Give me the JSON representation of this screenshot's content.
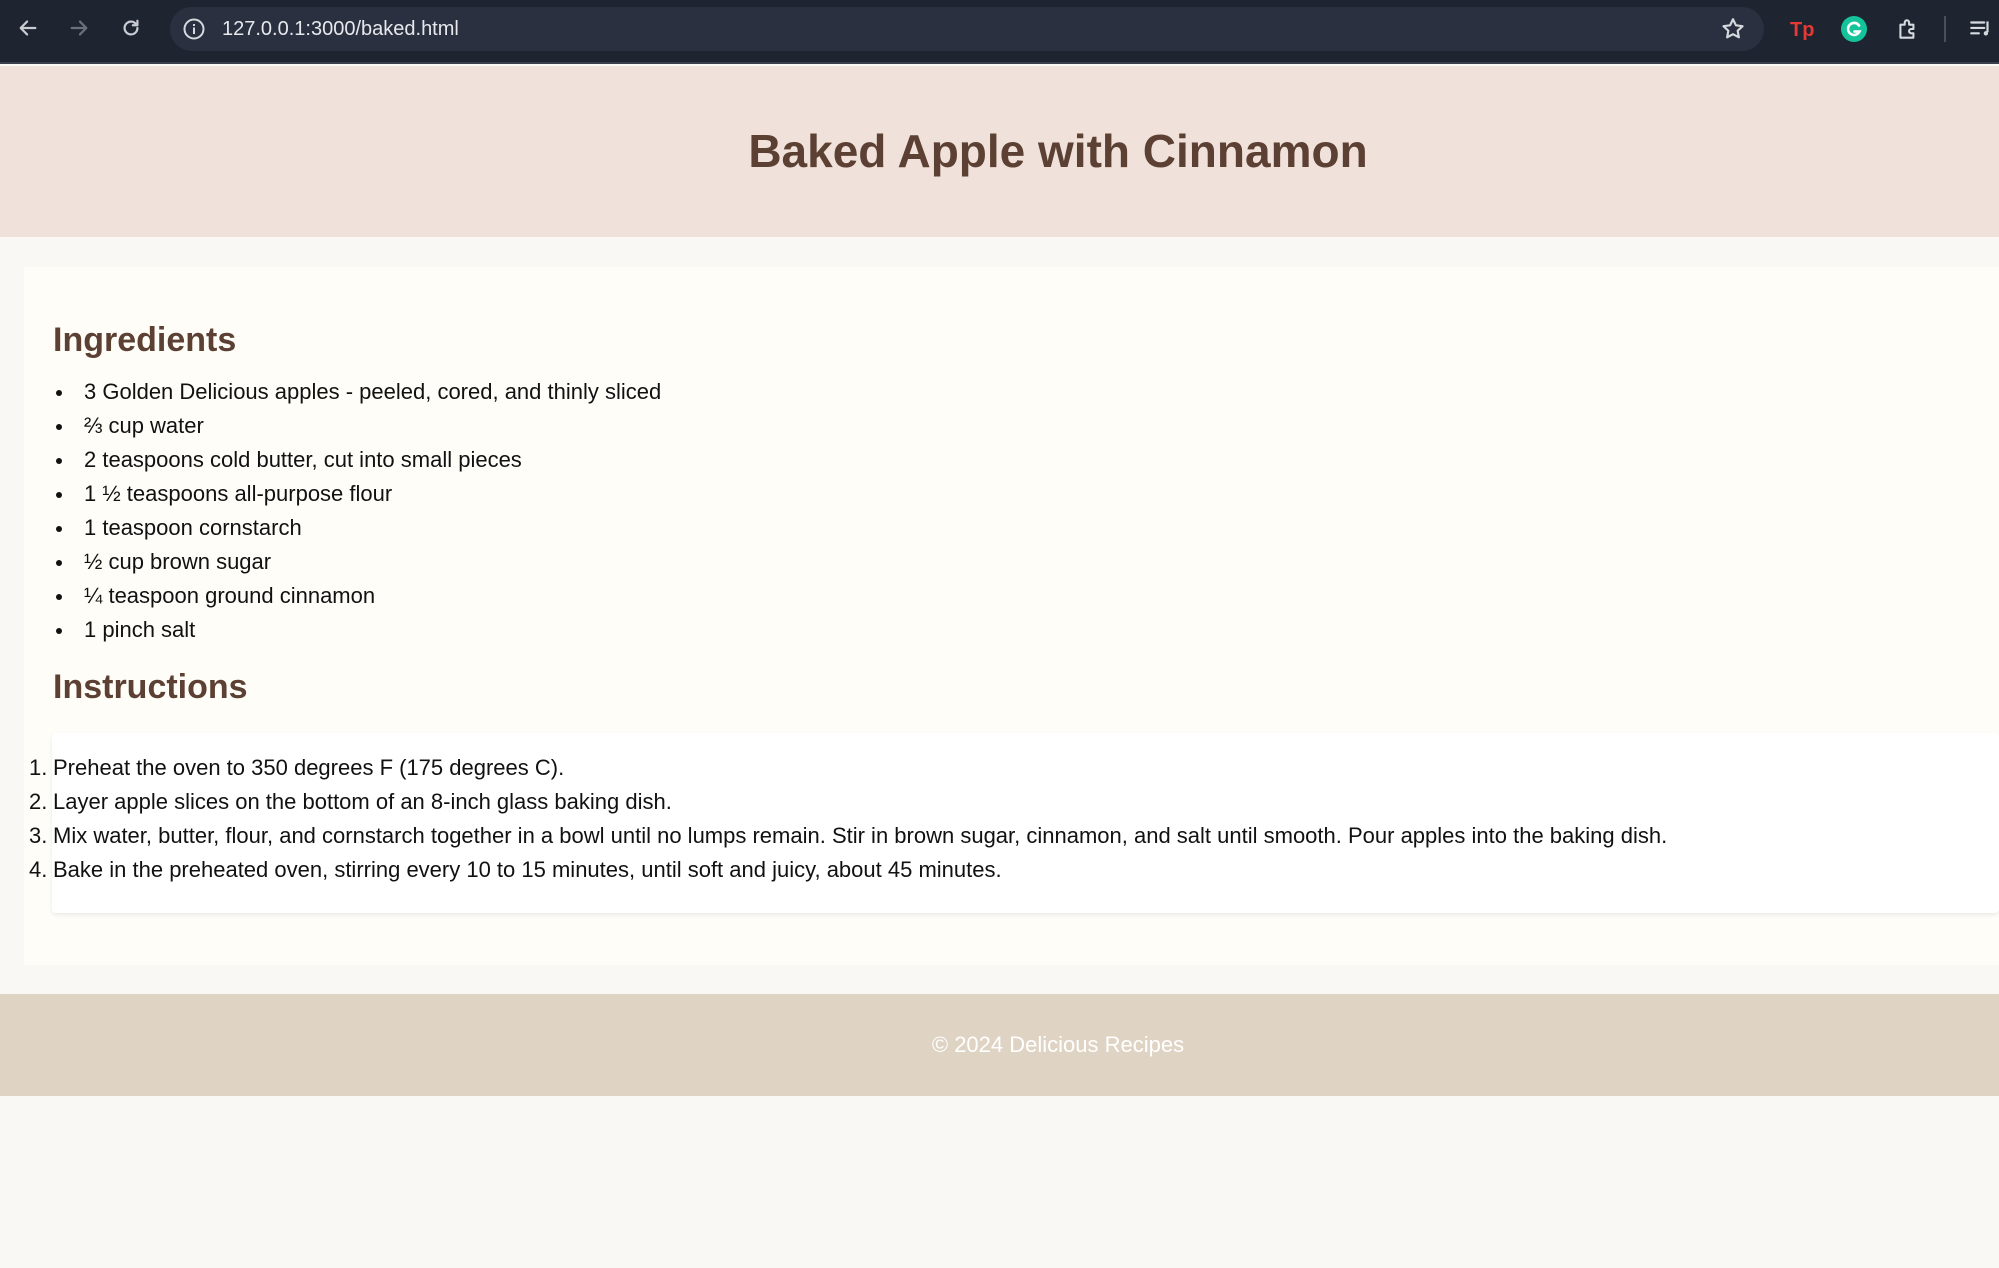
{
  "browser": {
    "url": "127.0.0.1:3000/baked.html",
    "icons": [
      "back-arrow-icon",
      "forward-arrow-icon",
      "reload-icon",
      "site-info-icon",
      "bookmark-star-icon",
      "tp-extension-icon",
      "grammarly-extension-icon",
      "extensions-puzzle-icon",
      "reading-list-icon"
    ]
  },
  "page": {
    "title": "Baked Apple with Cinnamon",
    "ingredients_heading": "Ingredients",
    "ingredients": [
      "3 Golden Delicious apples - peeled, cored, and thinly sliced",
      "⅔ cup water",
      "2 teaspoons cold butter, cut into small pieces",
      "1 ½ teaspoons all-purpose flour",
      "1 teaspoon cornstarch",
      "½ cup brown sugar",
      "¼ teaspoon ground cinnamon",
      "1 pinch salt"
    ],
    "instructions_heading": "Instructions",
    "instructions": [
      {
        "num": "1.",
        "text": "Preheat the oven to 350 degrees F (175 degrees C)."
      },
      {
        "num": "2.",
        "text": "Layer apple slices on the bottom of an 8-inch glass baking dish."
      },
      {
        "num": "3.",
        "text": "Mix water, butter, flour, and cornstarch together in a bowl until no lumps remain. Stir in brown sugar, cinnamon, and salt until smooth. Pour apples into the baking dish."
      },
      {
        "num": "4.",
        "text": "Bake in the preheated oven, stirring every 10 to 15 minutes, until soft and juicy, about 45 minutes."
      }
    ],
    "footer": "© 2024 Delicious Recipes"
  },
  "colors": {
    "header_bg": "#f0e2da",
    "heading_text": "#5c4033",
    "footer_bg": "#dfd3c4",
    "chrome_bg": "#1f2431"
  }
}
